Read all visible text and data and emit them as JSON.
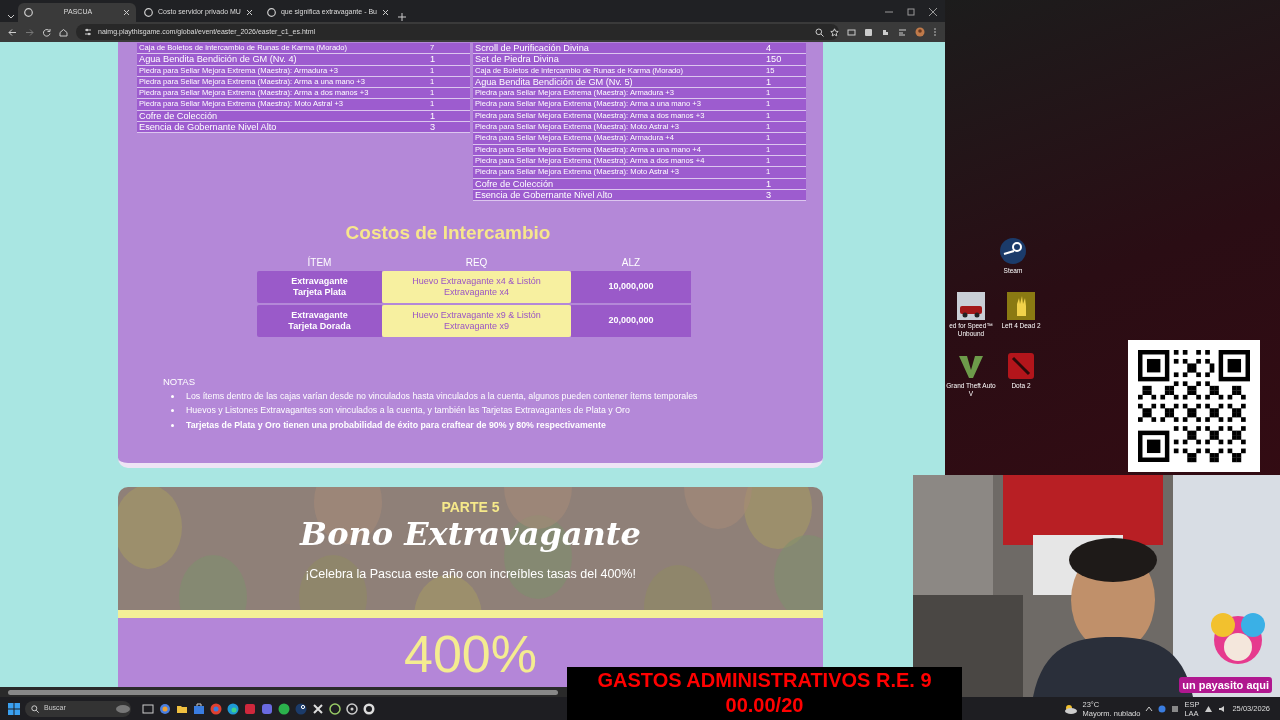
{
  "browser": {
    "tabs": [
      {
        "label": "PASCUA",
        "selected": true
      },
      {
        "label": "Costo servidor privado MU",
        "selected": false
      },
      {
        "label": "que significa extravagante - Bu",
        "selected": false
      }
    ],
    "url": "naimg.playthisgame.com/global/event/easter_2026/easter_c1_es.html"
  },
  "reward_tables": [
    {
      "rows": [
        {
          "item": "Caja de Boletos de intercambio de Runas de Karma (Morado)",
          "qty": "7",
          "large": false
        },
        {
          "item": "Agua Bendita Bendición de GM (Nv. 4)",
          "qty": "1",
          "large": true
        },
        {
          "item": "Piedra para Sellar Mejora Extrema (Maestra): Armadura +3",
          "qty": "1",
          "large": false
        },
        {
          "item": "Piedra para Sellar Mejora Extrema (Maestra): Arma a una mano +3",
          "qty": "1",
          "large": false
        },
        {
          "item": "Piedra para Sellar Mejora Extrema (Maestra): Arma a dos manos +3",
          "qty": "1",
          "large": false
        },
        {
          "item": "Piedra para Sellar Mejora Extrema (Maestra): Moto Astral +3",
          "qty": "1",
          "large": false
        },
        {
          "item": "Cofre de Colección",
          "qty": "1",
          "large": true
        },
        {
          "item": "Esencia de Gobernante Nivel Alto",
          "qty": "3",
          "large": true
        }
      ]
    },
    {
      "rows": [
        {
          "item": "Scroll de Purificación Divina",
          "qty": "4",
          "large": true
        },
        {
          "item": "Set de Piedra Divina",
          "qty": "150",
          "large": true
        },
        {
          "item": "Caja de Boletos de intercambio de Runas de Karma (Morado)",
          "qty": "15",
          "large": false
        },
        {
          "item": "Agua Bendita Bendición de GM (Nv. 5)",
          "qty": "1",
          "large": true
        },
        {
          "item": "Piedra para Sellar Mejora Extrema (Maestra): Armadura +3",
          "qty": "1",
          "large": false
        },
        {
          "item": "Piedra para Sellar Mejora Extrema (Maestra): Arma a una mano +3",
          "qty": "1",
          "large": false
        },
        {
          "item": "Piedra para Sellar Mejora Extrema (Maestra): Arma a dos manos +3",
          "qty": "1",
          "large": false
        },
        {
          "item": "Piedra para Sellar Mejora Extrema (Maestra): Moto Astral +3",
          "qty": "1",
          "large": false
        },
        {
          "item": "Piedra para Sellar Mejora Extrema (Maestra): Armadura +4",
          "qty": "1",
          "large": false
        },
        {
          "item": "Piedra para Sellar Mejora Extrema (Maestra): Arma a una mano +4",
          "qty": "1",
          "large": false
        },
        {
          "item": "Piedra para Sellar Mejora Extrema (Maestra): Arma a dos manos +4",
          "qty": "1",
          "large": false
        },
        {
          "item": "Piedra para Sellar Mejora Extrema (Maestra): Moto Astral +3",
          "qty": "1",
          "large": false
        },
        {
          "item": "Cofre de Colección",
          "qty": "1",
          "large": true
        },
        {
          "item": "Esencia de Gobernante Nivel Alto",
          "qty": "3",
          "large": true
        }
      ]
    }
  ],
  "exchange": {
    "title": "Costos de Intercambio",
    "columns": [
      "ÍTEM",
      "REQ",
      "ALZ"
    ],
    "rows": [
      {
        "item": "Extravagante Tarjeta Plata",
        "requirement": "Huevo Extravagante x4 & Listón Extravagante x4",
        "price": "10,000,000"
      },
      {
        "item": "Extravagante Tarjeta Dorada",
        "requirement": "Huevo Extravagante x9 & Listón Extravagante x9",
        "price": "20,000,000"
      }
    ]
  },
  "notes": {
    "title": "NOTAS",
    "items": [
      {
        "text": "Los ítems dentro de las cajas varían desde no vinculados hasta vinculados a la cuenta, algunos pueden contener ítems temporales",
        "bold": false
      },
      {
        "text": "Huevos y Listones Extravagantes son vinculados a la cuenta, y también las Tarjetas Extravagantes de Plata y Oro",
        "bold": false
      },
      {
        "text": "Tarjetas de Plata y Oro tienen una probabilidad de éxito para craftear de 90% y 80% respectivamente",
        "bold": true
      }
    ]
  },
  "bonus": {
    "part": "PARTE 5",
    "title": "Bono Extravagante",
    "subtitle": "¡Celebra la Pascua este año con increíbles tasas del 400%!",
    "rate": "400%"
  },
  "desktop_icons": [
    {
      "label": "Steam",
      "kind": "steam"
    },
    {
      "label": "ed for Speed™ Unbound",
      "kind": "car"
    },
    {
      "label": "Left 4 Dead 2",
      "kind": "hand"
    },
    {
      "label": "Grand Theft Auto V",
      "kind": "v"
    },
    {
      "label": "Dota 2",
      "kind": "red"
    }
  ],
  "caption": {
    "lines": [
      "GASTOS ADMINISTRATIVOS R.E. 9",
      "00.00/20"
    ]
  },
  "webcam": {
    "kind": "picture",
    "sticker": "un payasito aqui"
  },
  "taskbar": {
    "search_placeholder": "Buscar",
    "weather": {
      "temp": "23°C",
      "desc": "Mayorm. nublado"
    },
    "language": [
      "ESP",
      "LAA"
    ],
    "date": "25/03/2026"
  }
}
